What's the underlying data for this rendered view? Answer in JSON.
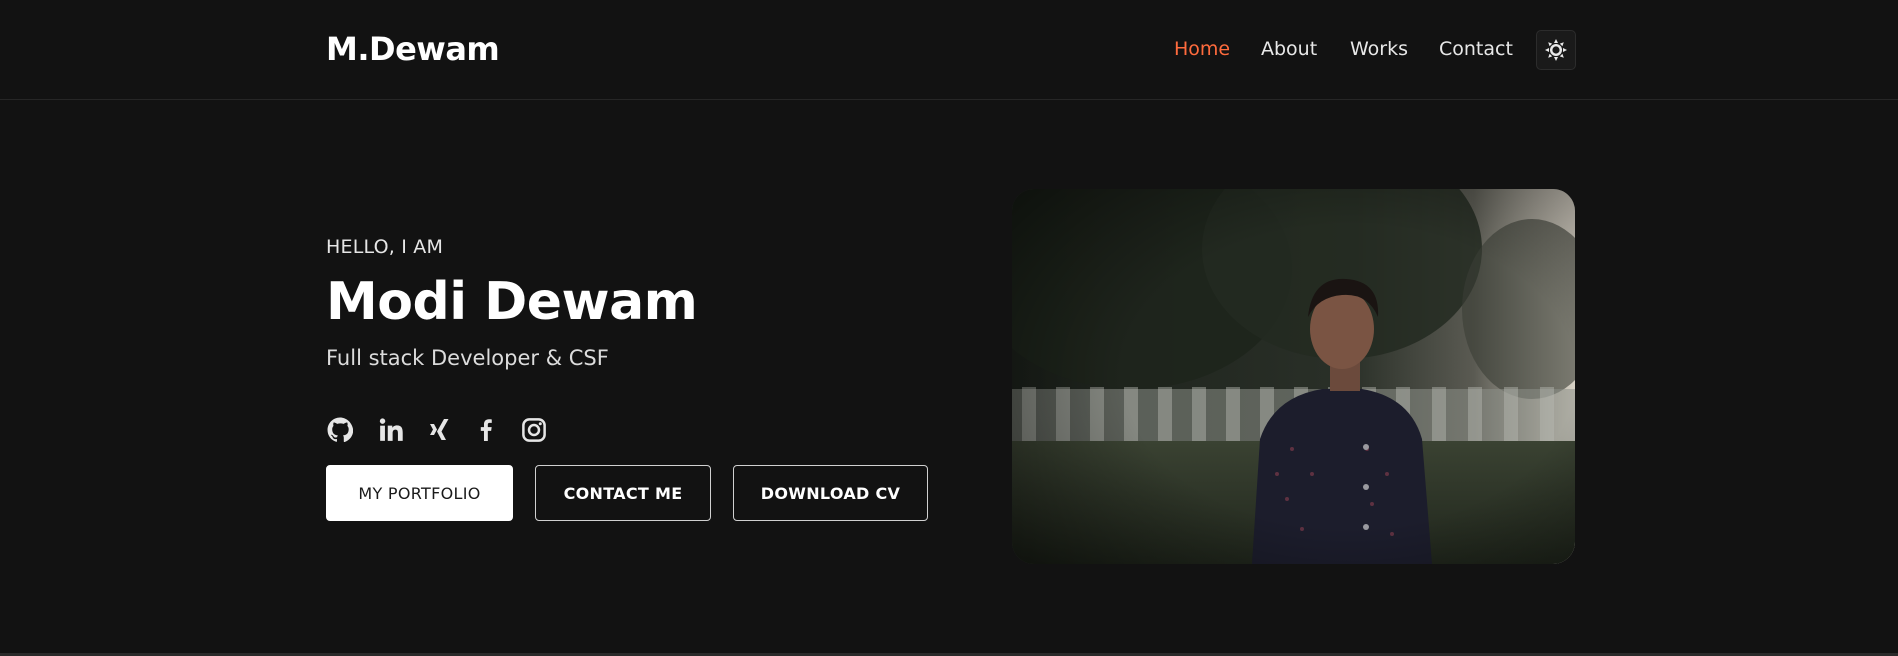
{
  "brand": {
    "logo_text": "M.Dewam"
  },
  "nav": {
    "items": [
      {
        "label": "Home",
        "active": true
      },
      {
        "label": "About",
        "active": false
      },
      {
        "label": "Works",
        "active": false
      },
      {
        "label": "Contact",
        "active": false
      }
    ],
    "theme_toggle_icon": "sun-icon"
  },
  "hero": {
    "greeting": "HELLO, I AM",
    "name": "Modi Dewam",
    "role": "Full stack Developer & CSF",
    "socials": [
      "github-icon",
      "linkedin-icon",
      "xing-icon",
      "facebook-icon",
      "instagram-icon"
    ],
    "buttons": {
      "portfolio": "MY PORTFOLIO",
      "contact": "CONTACT ME",
      "download": "DOWNLOAD CV"
    },
    "photo_subject": "portrait-photo"
  },
  "colors": {
    "background": "#121212",
    "accent": "#ff6b3d",
    "text": "#ffffff"
  }
}
